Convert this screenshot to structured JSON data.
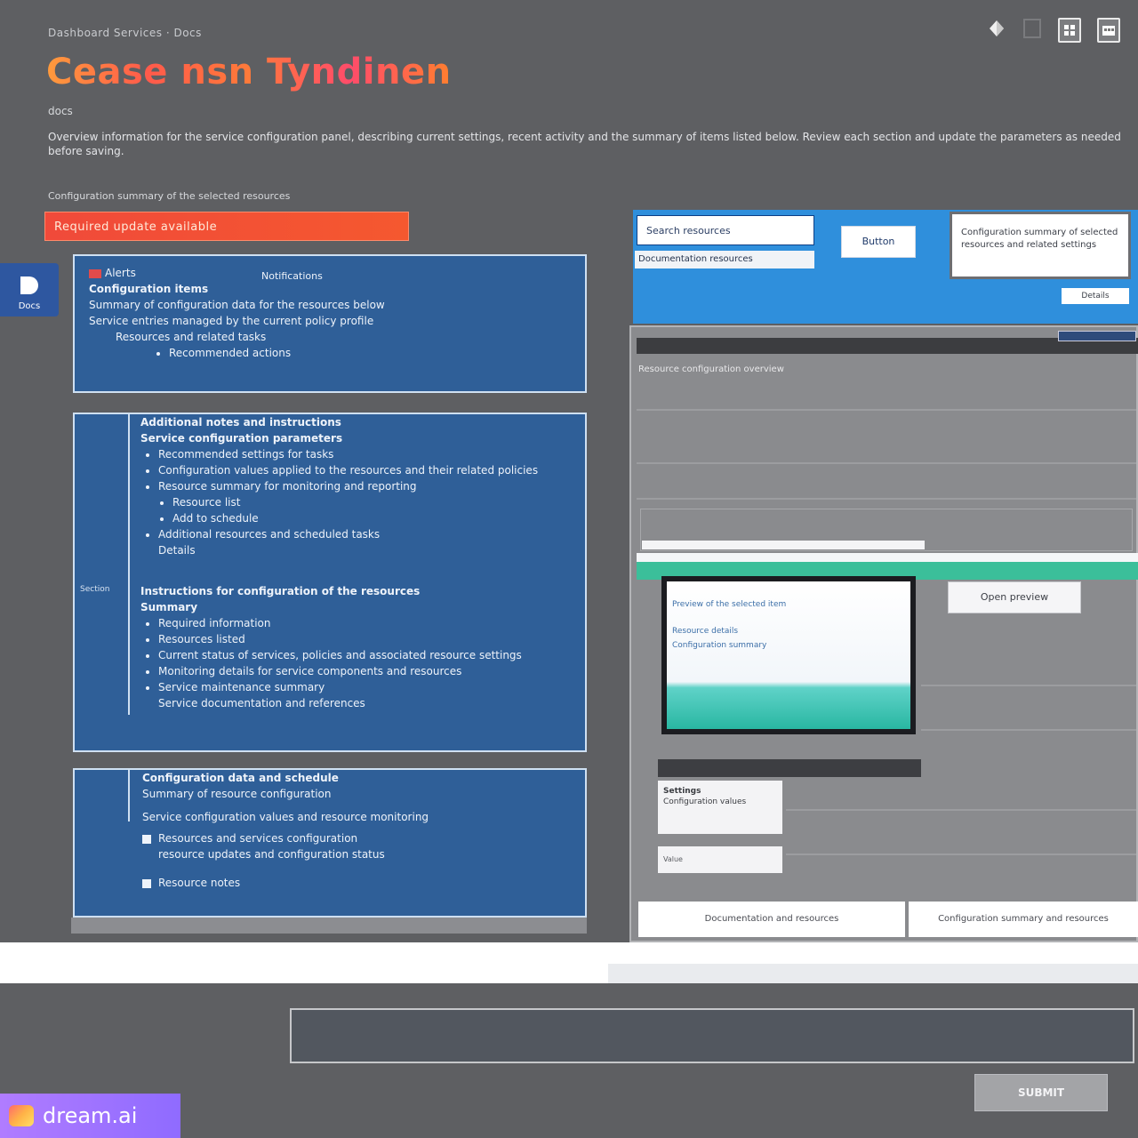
{
  "header": {
    "breadcrumb": "Dashboard Services · Docs",
    "title": "Cease nsn Tyndinen",
    "subtitle": "docs",
    "description": "Overview information for the service configuration panel, describing current settings, recent activity and the summary of items listed below. Review each section and update the parameters as needed before saving.",
    "section_label": "Configuration summary of the selected resources",
    "red_bar_label": "Required update available"
  },
  "topbar_icons": [
    "diamond-icon",
    "window-icon",
    "grid-icon",
    "calendar-icon"
  ],
  "side_tab": {
    "label": "Docs"
  },
  "panel1": {
    "flag_label": "Alerts",
    "center_label": "Notifications",
    "heading": "Configuration items",
    "lines": [
      "Summary of configuration data for the resources below",
      "Service entries managed by the current policy profile",
      "Resources and related tasks"
    ],
    "bullet": "Recommended actions"
  },
  "panel2": {
    "blocks": [
      {
        "gutter_label": "",
        "heading": "Additional notes and instructions",
        "subheading": "Service configuration parameters",
        "lines": [
          "Recommended settings for tasks",
          "Configuration values applied to the resources and their related policies",
          "Resource summary for monitoring and reporting",
          "Resource list",
          "Add to schedule",
          "Additional resources and scheduled tasks",
          "Details"
        ]
      },
      {
        "gutter_label": "Section",
        "heading": "Instructions for configuration of the resources",
        "subheading": "Summary",
        "lines": [
          "Required information",
          "Resources listed",
          "Current status of services, policies and associated resource settings",
          "Monitoring details for service components and resources",
          "Service maintenance summary",
          "Service documentation and references"
        ]
      }
    ]
  },
  "panel3": {
    "heading": "Configuration data and schedule",
    "subheading": "Summary of resource configuration",
    "lines": [
      "Service configuration values and resource monitoring",
      "Resources and services configuration",
      "resource updates and configuration status",
      "Resource notes"
    ]
  },
  "right": {
    "search_input": "Search resources",
    "search_label": "Documentation resources",
    "action_button": "Button",
    "card_text": "Configuration summary of selected resources and related settings",
    "small_button": "Details",
    "gray_heading": "Resource configuration overview",
    "preview_lines": [
      "Preview of the selected item",
      "Resource details",
      "Configuration summary"
    ],
    "preview_button": "Open preview",
    "mini_card_title": "Settings",
    "mini_card_body": "Configuration values",
    "mini_input": "Value",
    "footer_left": "Documentation and resources",
    "footer_right": "Configuration summary and resources"
  },
  "bottom": {
    "input_placeholder": "",
    "button_label": "SUBMIT"
  },
  "watermark": {
    "text": "dream.ai"
  }
}
